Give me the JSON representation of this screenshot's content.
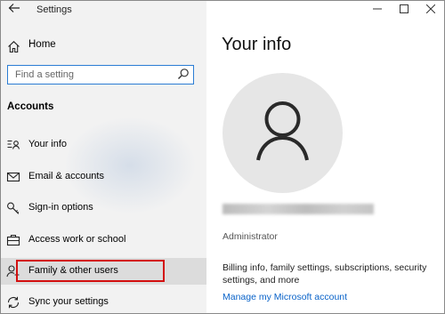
{
  "window": {
    "title": "Settings"
  },
  "sidebar": {
    "home_label": "Home",
    "search_placeholder": "Find a setting",
    "section_title": "Accounts",
    "items": [
      {
        "label": "Your info",
        "icon": "contact-card-icon"
      },
      {
        "label": "Email & accounts",
        "icon": "mail-icon"
      },
      {
        "label": "Sign-in options",
        "icon": "key-icon"
      },
      {
        "label": "Access work or school",
        "icon": "briefcase-icon"
      },
      {
        "label": "Family & other users",
        "icon": "person-add-icon",
        "selected": true
      },
      {
        "label": "Sync your settings",
        "icon": "sync-icon"
      }
    ]
  },
  "main": {
    "title": "Your info",
    "account_type": "Administrator",
    "billing_text": "Billing info, family settings, subscriptions, security settings, and more",
    "manage_link": "Manage my Microsoft account"
  },
  "colors": {
    "accent": "#0a63c9",
    "highlight_border": "#d30f0f",
    "sidebar_bg": "#f2f2f2",
    "selected_bg": "#dcdcdc"
  }
}
